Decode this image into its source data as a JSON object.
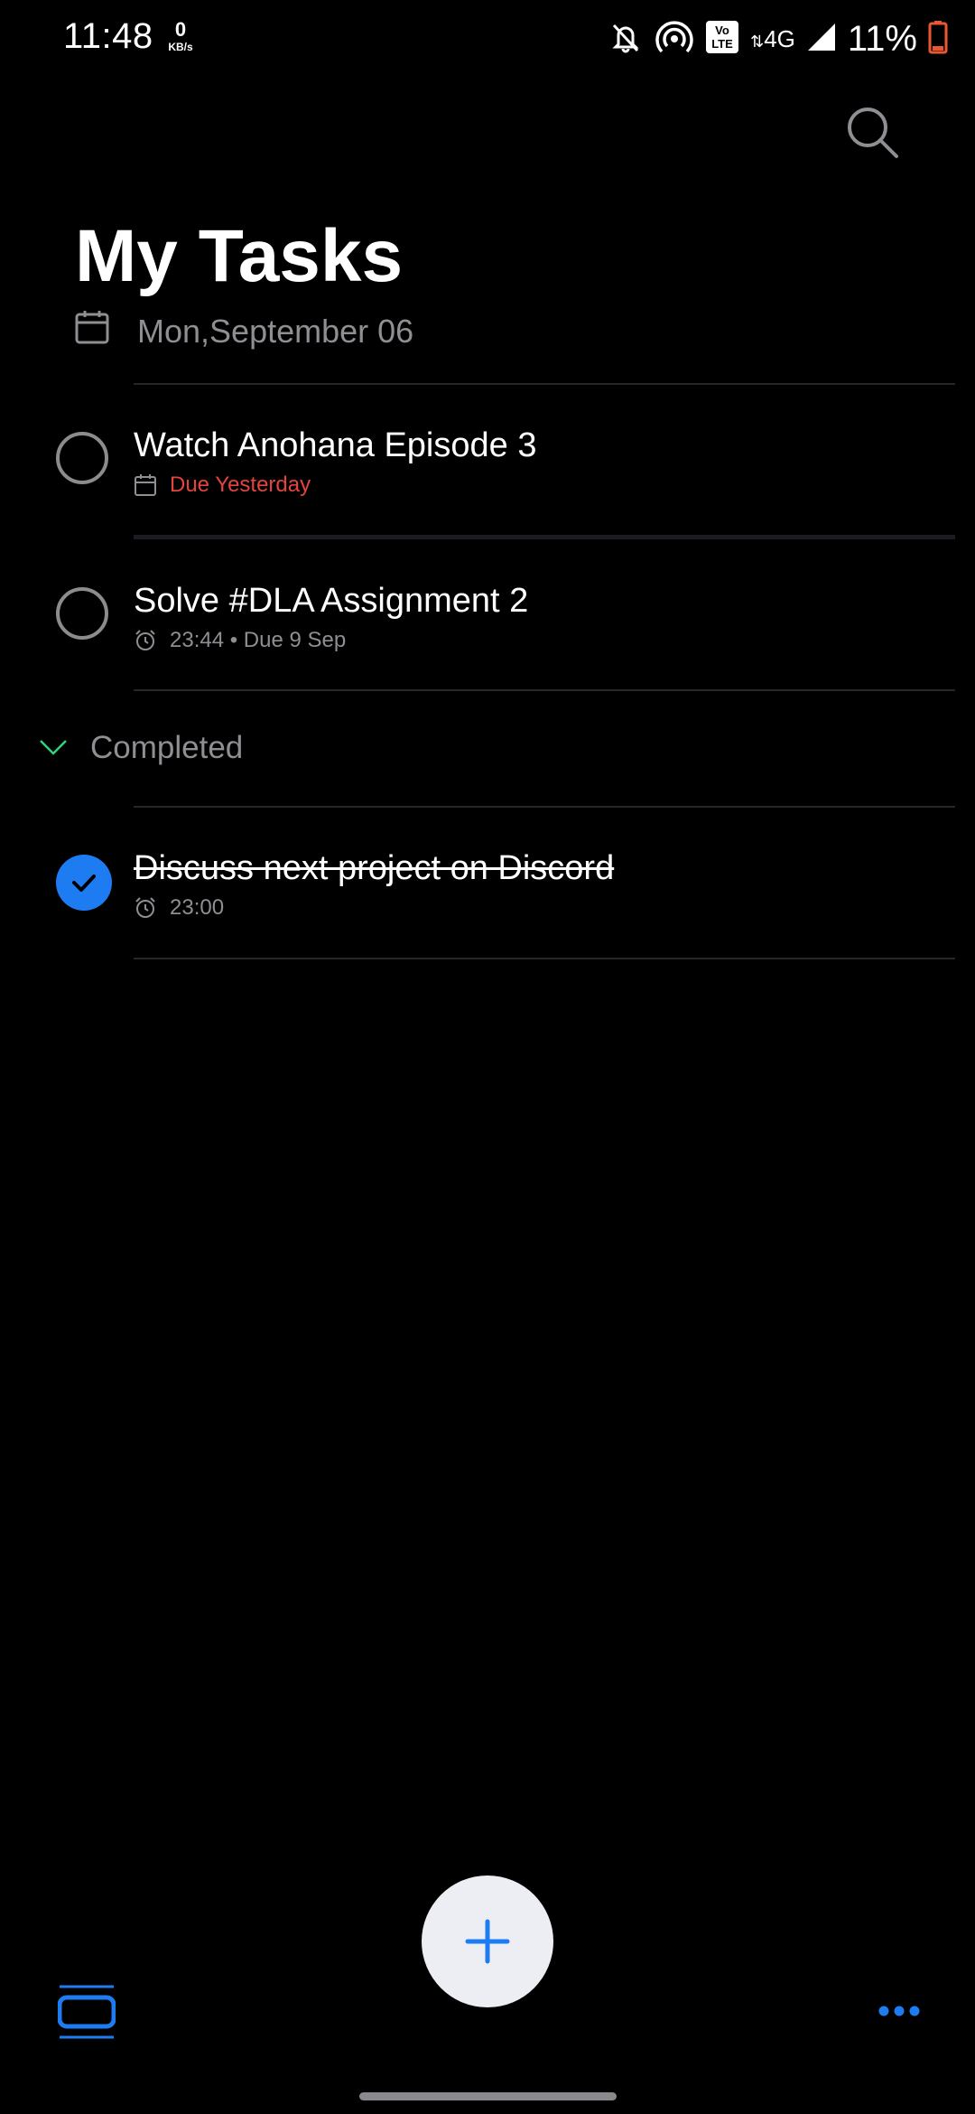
{
  "status_bar": {
    "time": "11:48",
    "net_speed_value": "0",
    "net_speed_unit": "KB/s",
    "volte": "Vo LTE",
    "network": "4G",
    "battery_percent": "11%",
    "battery_color": "#e8572f"
  },
  "header": {
    "title": "My Tasks",
    "date": "Mon,September 06",
    "search_icon": "search-icon"
  },
  "tasks": [
    {
      "title": "Watch Anohana Episode 3",
      "meta_icon": "calendar-icon",
      "meta_text": "Due Yesterday",
      "overdue": true,
      "completed": false
    },
    {
      "title": "Solve #DLA Assignment 2",
      "meta_icon": "alarm-icon",
      "meta_text": "23:44 • Due 9 Sep",
      "overdue": false,
      "completed": false
    }
  ],
  "completed_section": {
    "label": "Completed",
    "expanded": true,
    "tasks": [
      {
        "title": "Discuss next project on Discord",
        "meta_icon": "alarm-icon",
        "meta_text": "23:00",
        "completed": true
      }
    ]
  },
  "fab": {
    "icon": "plus-icon"
  },
  "bottom_bar": {
    "left_icon": "task-lists-icon",
    "right_icon": "more-options-icon"
  },
  "colors": {
    "accent": "#1e7cf2",
    "overdue": "#e5443e",
    "background": "#000000",
    "secondary_text": "#8e8e93"
  }
}
